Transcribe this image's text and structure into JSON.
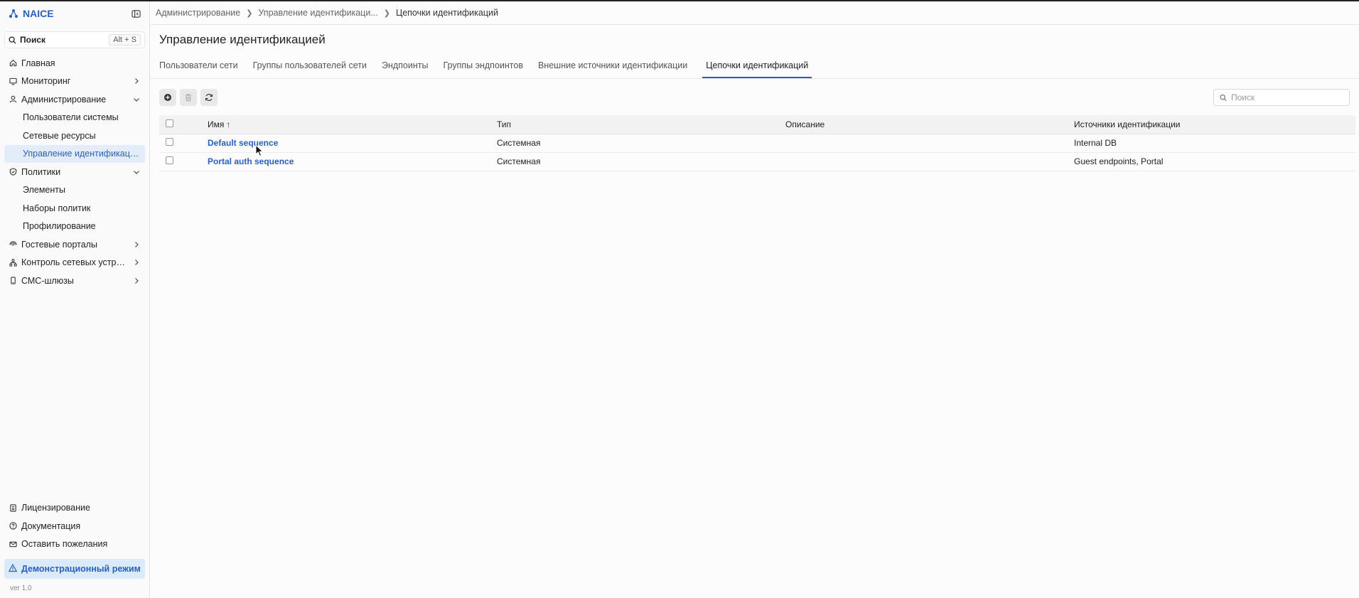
{
  "brand": {
    "name": "NAICE"
  },
  "search": {
    "label": "Поиск",
    "shortcut": "Alt + S"
  },
  "sidebar": {
    "items": [
      {
        "label": "Главная",
        "icon": "home-icon"
      },
      {
        "label": "Мониторинг",
        "icon": "monitor-icon",
        "chevron": "right"
      },
      {
        "label": "Администрирование",
        "icon": "user-icon",
        "chevron": "down"
      },
      {
        "label": "Пользователи системы",
        "sub": true
      },
      {
        "label": "Сетевые ресурсы",
        "sub": true
      },
      {
        "label": "Управление идентификацией",
        "sub": true,
        "active": true
      },
      {
        "label": "Политики",
        "icon": "shield-icon",
        "chevron": "down"
      },
      {
        "label": "Элементы",
        "sub": true
      },
      {
        "label": "Наборы политик",
        "sub": true
      },
      {
        "label": "Профилирование",
        "sub": true
      },
      {
        "label": "Гостевые порталы",
        "icon": "wifi-icon",
        "chevron": "right"
      },
      {
        "label": "Контроль сетевых устро...",
        "icon": "network-icon",
        "chevron": "right"
      },
      {
        "label": "СМС-шлюзы",
        "icon": "phone-icon",
        "chevron": "right"
      }
    ],
    "bottom": [
      {
        "label": "Лицензирование",
        "icon": "license-icon"
      },
      {
        "label": "Документация",
        "icon": "help-icon"
      },
      {
        "label": "Оставить пожелания",
        "icon": "mail-icon"
      }
    ],
    "demo_label": "Демонстрационный режим",
    "version": "ver 1.0"
  },
  "breadcrumb": {
    "items": [
      "Администрирование",
      "Управление идентификаци...",
      "Цепочки идентификаций"
    ]
  },
  "page": {
    "title": "Управление идентификацией"
  },
  "tabs": [
    {
      "label": "Пользователи сети"
    },
    {
      "label": "Группы пользователей сети"
    },
    {
      "label": "Эндпоинты"
    },
    {
      "label": "Группы эндпоинтов"
    },
    {
      "label": "Внешние источники идентификации"
    },
    {
      "label": "Цепочки идентификаций",
      "active": true
    }
  ],
  "toolbar": {
    "search_placeholder": "Поиск"
  },
  "table": {
    "columns": [
      "Имя",
      "Тип",
      "Описание",
      "Источники идентификации"
    ],
    "rows": [
      {
        "name": "Default sequence",
        "type": "Системная",
        "description": "",
        "sources": "Internal DB"
      },
      {
        "name": "Portal auth sequence",
        "type": "Системная",
        "description": "",
        "sources": "Guest endpoints, Portal"
      }
    ]
  },
  "colors": {
    "accent": "#2c5fb8",
    "active_bg": "#e3ecf9",
    "demo_bg": "#dbeaf8"
  }
}
